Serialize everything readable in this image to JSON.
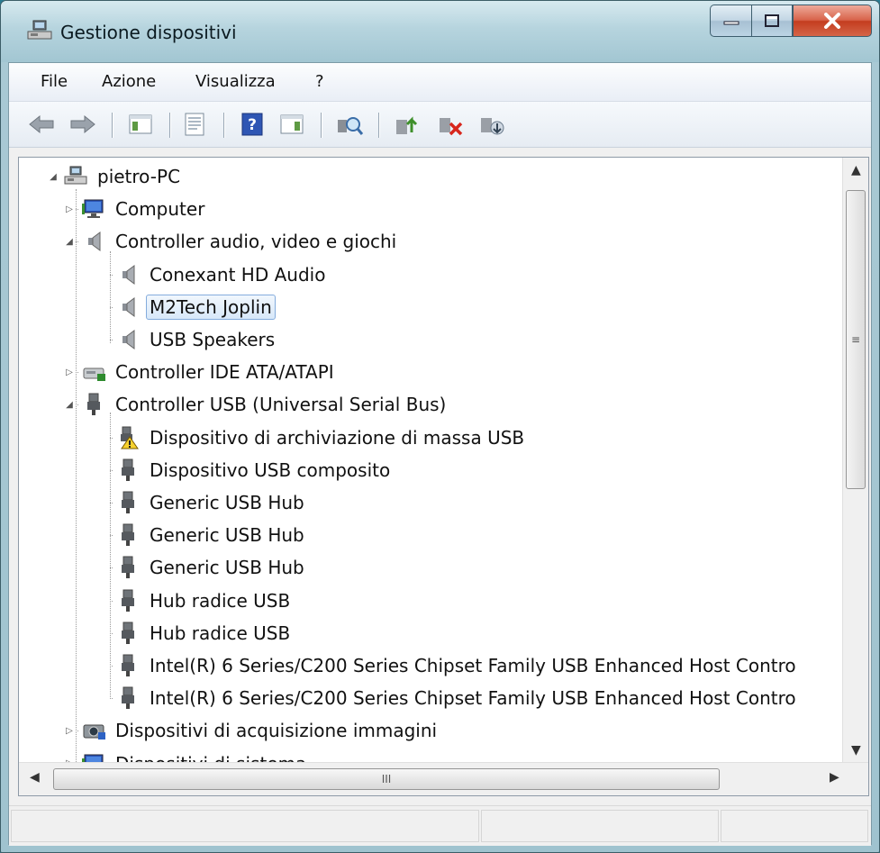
{
  "window": {
    "title": "Gestione dispositivi"
  },
  "menu": [
    "File",
    "Azione",
    "Visualizza",
    "?"
  ],
  "toolbar": {
    "icons": [
      "back-arrow-icon",
      "forward-arrow-icon",
      "console-tree-icon",
      "properties-icon",
      "help-icon",
      "action-pane-icon",
      "scan-hardware-icon",
      "update-driver-icon",
      "disable-device-icon",
      "uninstall-device-icon"
    ]
  },
  "tree": {
    "root": "pietro-PC",
    "items": [
      {
        "label": "Computer",
        "level": 1,
        "expanded": false,
        "icon": "monitor-icon"
      },
      {
        "label": "Controller audio, video e giochi",
        "level": 1,
        "expanded": true,
        "icon": "speaker-icon"
      },
      {
        "label": "Conexant HD Audio",
        "level": 2,
        "icon": "speaker-icon"
      },
      {
        "label": "M2Tech Joplin",
        "level": 2,
        "icon": "speaker-icon",
        "selected": true
      },
      {
        "label": "USB Speakers",
        "level": 2,
        "icon": "speaker-icon"
      },
      {
        "label": "Controller IDE ATA/ATAPI",
        "level": 1,
        "expanded": false,
        "icon": "ide-controller-icon"
      },
      {
        "label": "Controller USB (Universal Serial Bus)",
        "level": 1,
        "expanded": true,
        "icon": "usb-plug-icon"
      },
      {
        "label": "Dispositivo di archiviazione di massa USB",
        "level": 2,
        "icon": "usb-warning-icon"
      },
      {
        "label": "Dispositivo USB composito",
        "level": 2,
        "icon": "usb-plug-icon"
      },
      {
        "label": "Generic USB Hub",
        "level": 2,
        "icon": "usb-plug-icon"
      },
      {
        "label": "Generic USB Hub",
        "level": 2,
        "icon": "usb-plug-icon"
      },
      {
        "label": "Generic USB Hub",
        "level": 2,
        "icon": "usb-plug-icon"
      },
      {
        "label": "Hub radice USB",
        "level": 2,
        "icon": "usb-plug-icon"
      },
      {
        "label": "Hub radice USB",
        "level": 2,
        "icon": "usb-plug-icon"
      },
      {
        "label": "Intel(R) 6 Series/C200 Series Chipset Family USB Enhanced Host Contro",
        "level": 2,
        "icon": "usb-plug-icon"
      },
      {
        "label": "Intel(R) 6 Series/C200 Series Chipset Family USB Enhanced Host Contro",
        "level": 2,
        "icon": "usb-plug-icon"
      },
      {
        "label": "Dispositivi di acquisizione immagini",
        "level": 1,
        "expanded": false,
        "icon": "camera-icon"
      },
      {
        "label": "Dispositivi di sistema",
        "level": 1,
        "expanded": false,
        "icon": "monitor-icon"
      }
    ]
  },
  "scrollbar": {
    "grip": "≡",
    "hgrip": "III"
  }
}
